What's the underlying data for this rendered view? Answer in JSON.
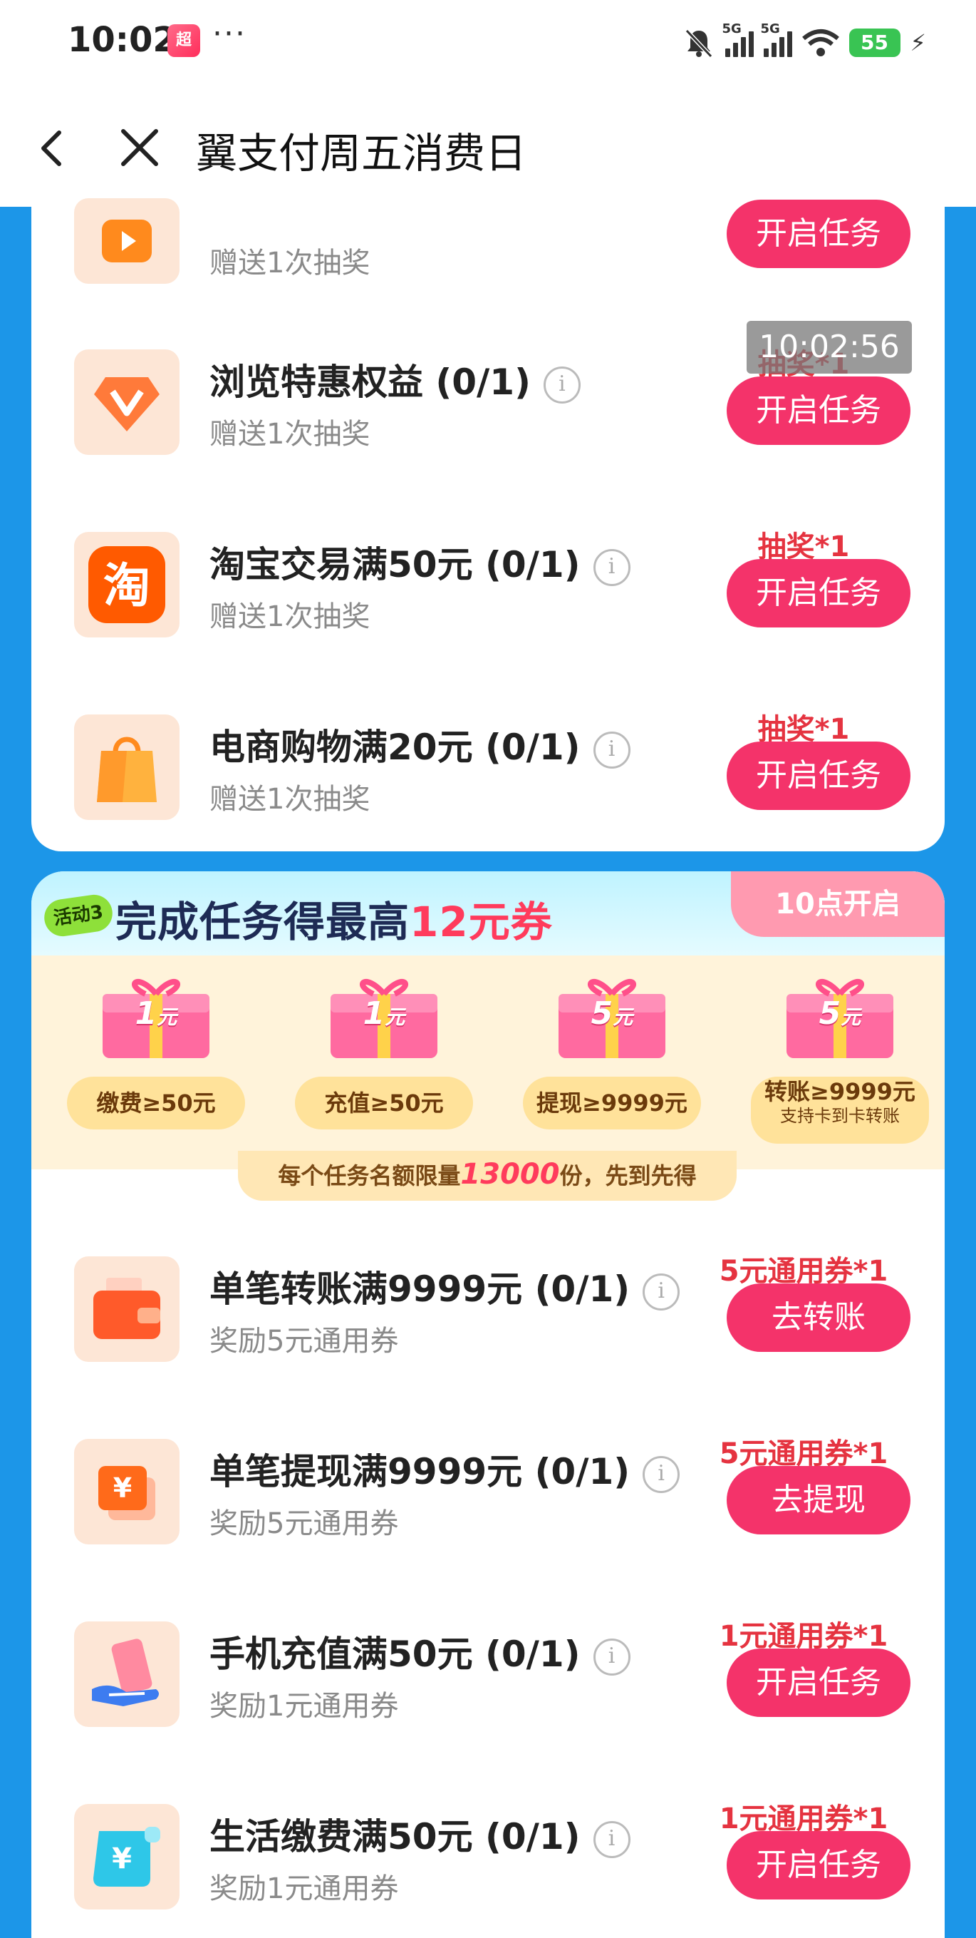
{
  "status_bar": {
    "time": "10:02",
    "app_badge": "超",
    "more": "···",
    "signal_1": "5G",
    "signal_2": "5G",
    "battery": "55"
  },
  "nav": {
    "title": "翼支付周五消费日"
  },
  "timestamp_overlay": "10:02:56",
  "top_tasks": [
    {
      "title": "",
      "subtitle": "赠送1次抽奖",
      "reward": "",
      "button": "开启任务",
      "icon": "video-play-icon"
    },
    {
      "title": "浏览特惠权益 (0/1)",
      "subtitle": "赠送1次抽奖",
      "reward": "抽奖*1",
      "button": "开启任务",
      "icon": "diamond-v-icon"
    },
    {
      "title": "淘宝交易满50元 (0/1)",
      "subtitle": "赠送1次抽奖",
      "reward": "抽奖*1",
      "button": "开启任务",
      "icon": "taobao-icon"
    },
    {
      "title": "电商购物满20元 (0/1)",
      "subtitle": "赠送1次抽奖",
      "reward": "抽奖*1",
      "button": "开启任务",
      "icon": "shopping-bag-icon"
    }
  ],
  "activity": {
    "tag": "活动3",
    "title_prefix": "完成任务得最高",
    "title_highlight": "12元券",
    "open_time": "10点开启",
    "prizes": [
      {
        "amount": "1",
        "unit": "元",
        "condition": "缴费≥50元",
        "sub": ""
      },
      {
        "amount": "1",
        "unit": "元",
        "condition": "充值≥50元",
        "sub": ""
      },
      {
        "amount": "5",
        "unit": "元",
        "condition": "提现≥9999元",
        "sub": ""
      },
      {
        "amount": "5",
        "unit": "元",
        "condition": "转账≥9999元",
        "sub": "支持卡到卡转账"
      }
    ],
    "note_prefix": "每个任务名额限量",
    "note_number": "13000",
    "note_suffix": "份，先到先得"
  },
  "activity_tasks": [
    {
      "title": "单笔转账满9999元 (0/1)",
      "subtitle": "奖励5元通用券",
      "reward": "5元通用券*1",
      "button": "去转账",
      "icon": "wallet-icon"
    },
    {
      "title": "单笔提现满9999元 (0/1)",
      "subtitle": "奖励5元通用券",
      "reward": "5元通用券*1",
      "button": "去提现",
      "icon": "yuan-card-icon"
    },
    {
      "title": "手机充值满50元 (0/1)",
      "subtitle": "奖励1元通用券",
      "reward": "1元通用券*1",
      "button": "开启任务",
      "icon": "phone-hand-icon"
    },
    {
      "title": "生活缴费满50元 (0/1)",
      "subtitle": "奖励1元通用券",
      "reward": "1元通用券*1",
      "button": "开启任务",
      "icon": "yuan-scroll-icon"
    }
  ],
  "colors": {
    "background": "#1c96e8",
    "button": "#f4336a",
    "reward_text": "#e53340"
  }
}
